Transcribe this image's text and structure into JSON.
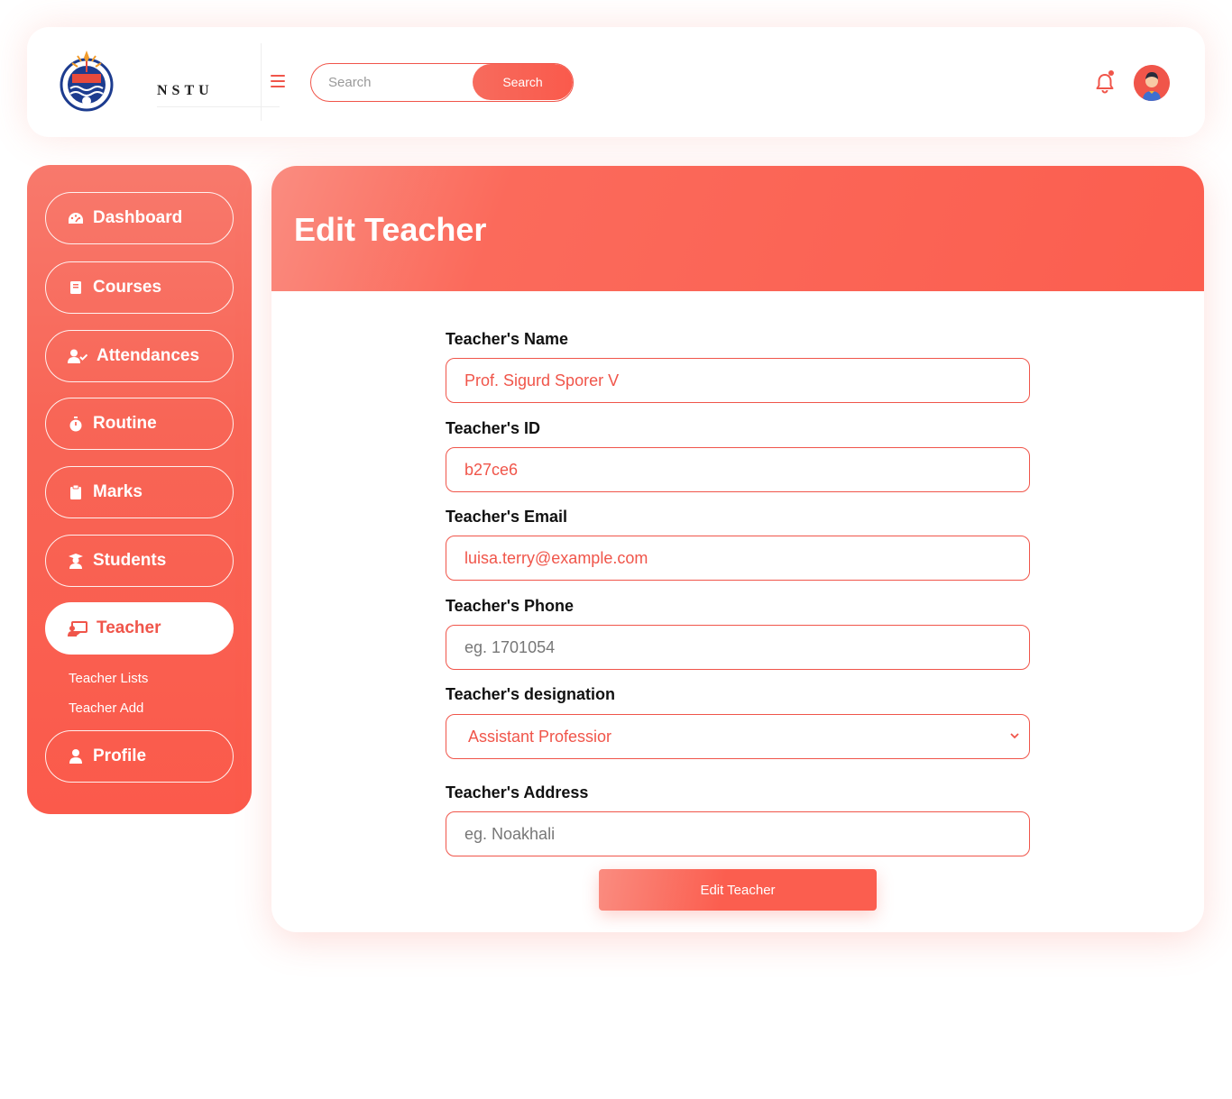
{
  "header": {
    "logo_text": "NSTU",
    "search": {
      "placeholder": "Search",
      "button_label": "Search"
    },
    "notification_icon": "bell-icon",
    "has_notification_dot": true
  },
  "sidebar": {
    "items": [
      {
        "label": "Dashboard",
        "icon": "gauge-icon"
      },
      {
        "label": "Courses",
        "icon": "book-icon"
      },
      {
        "label": "Attendances",
        "icon": "user-check-icon"
      },
      {
        "label": "Routine",
        "icon": "stopwatch-icon"
      },
      {
        "label": "Marks",
        "icon": "clipboard-icon"
      },
      {
        "label": "Students",
        "icon": "graduate-icon"
      },
      {
        "label": "Teacher",
        "icon": "chalkboard-teacher-icon",
        "active": true
      },
      {
        "label": "Profile",
        "icon": "user-icon"
      }
    ],
    "teacher_sub": [
      "Teacher Lists",
      "Teacher Add"
    ]
  },
  "page": {
    "title": "Edit Teacher",
    "fields": {
      "name": {
        "label": "Teacher's Name",
        "value": "Prof. Sigurd Sporer V"
      },
      "id": {
        "label": "Teacher's ID",
        "value": "b27ce6"
      },
      "email": {
        "label": "Teacher's Email",
        "value": "luisa.terry@example.com"
      },
      "phone": {
        "label": "Teacher's Phone",
        "placeholder": "eg. 1701054"
      },
      "designation": {
        "label": "Teacher's designation",
        "selected": "Assistant Professior"
      },
      "address": {
        "label": "Teacher's Address",
        "placeholder": "eg. Noakhali"
      }
    },
    "submit_label": "Edit Teacher"
  },
  "colors": {
    "accent": "#f0554a",
    "sidebar_bg": "#fb5e4f",
    "white": "#ffffff"
  }
}
